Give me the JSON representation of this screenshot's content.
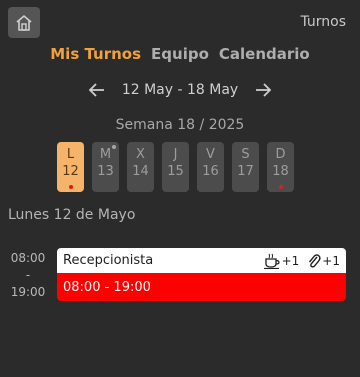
{
  "header": {
    "title": "Turnos",
    "home_icon": "home-icon"
  },
  "tabs": [
    {
      "label": "Mis Turnos",
      "active": true
    },
    {
      "label": "Equipo",
      "active": false
    },
    {
      "label": "Calendario",
      "active": false
    }
  ],
  "week_nav": {
    "range": "12 May - 18 May",
    "prev_icon": "arrow-left-icon",
    "next_icon": "arrow-right-icon"
  },
  "week_label": "Semana 18 / 2025",
  "days": [
    {
      "letter": "L",
      "number": "12",
      "selected": true
    },
    {
      "letter": "M",
      "number": "13"
    },
    {
      "letter": "X",
      "number": "14"
    },
    {
      "letter": "J",
      "number": "15"
    },
    {
      "letter": "V",
      "number": "16"
    },
    {
      "letter": "S",
      "number": "17"
    },
    {
      "letter": "D",
      "number": "18"
    }
  ],
  "day_heading": "Lunes 12 de Mayo",
  "time_range": {
    "start": "08:00",
    "separator": "-",
    "end": "19:00"
  },
  "shift": {
    "role": "Recepcionista",
    "time": "08:00 - 19:00",
    "color": "#ff0000",
    "break_count": "+1",
    "attachment_count": "+1",
    "break_icon": "coffee-icon",
    "attachment_icon": "paperclip-icon"
  },
  "colors": {
    "accent": "#f0a03c",
    "background": "#2b2b2b",
    "dot": "#e01b1b"
  }
}
